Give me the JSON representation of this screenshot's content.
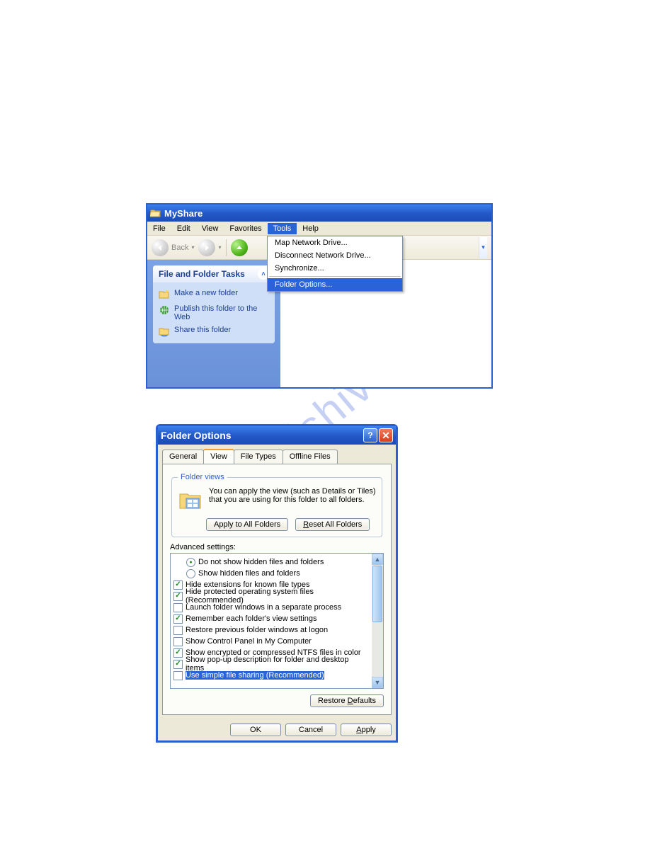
{
  "watermark": "manualshive.com",
  "explorer": {
    "title": "MyShare",
    "menu": {
      "items": [
        "File",
        "Edit",
        "View",
        "Favorites",
        "Tools",
        "Help"
      ],
      "active_index": 4
    },
    "toolbar": {
      "back_label": "Back"
    },
    "tools_menu": [
      "Map Network Drive...",
      "Disconnect Network Drive...",
      "Synchronize..."
    ],
    "tools_menu_selected": "Folder Options...",
    "tasks": {
      "header": "File and Folder Tasks",
      "links": [
        "Make a new folder",
        "Publish this folder to the Web",
        "Share this folder"
      ]
    }
  },
  "dialog": {
    "title": "Folder Options",
    "tabs": [
      "General",
      "View",
      "File Types",
      "Offline Files"
    ],
    "active_tab_index": 1,
    "folder_views": {
      "legend": "Folder views",
      "text": "You can apply the view (such as Details or Tiles) that you are using for this folder to all folders.",
      "apply_btn": "Apply to All Folders",
      "reset_btn": "Reset All Folders"
    },
    "advanced_label": "Advanced settings:",
    "advanced_items": [
      {
        "type": "radio",
        "indent": true,
        "checked": true,
        "label": "Do not show hidden files and folders"
      },
      {
        "type": "radio",
        "indent": true,
        "checked": false,
        "label": "Show hidden files and folders"
      },
      {
        "type": "checkbox",
        "checked": true,
        "label": "Hide extensions for known file types"
      },
      {
        "type": "checkbox",
        "checked": true,
        "label": "Hide protected operating system files (Recommended)"
      },
      {
        "type": "checkbox",
        "checked": false,
        "label": "Launch folder windows in a separate process"
      },
      {
        "type": "checkbox",
        "checked": true,
        "label": "Remember each folder's view settings"
      },
      {
        "type": "checkbox",
        "checked": false,
        "label": "Restore previous folder windows at logon"
      },
      {
        "type": "checkbox",
        "checked": false,
        "label": "Show Control Panel in My Computer"
      },
      {
        "type": "checkbox",
        "checked": true,
        "label": "Show encrypted or compressed NTFS files in color"
      },
      {
        "type": "checkbox",
        "checked": true,
        "label": "Show pop-up description for folder and desktop items"
      },
      {
        "type": "checkbox",
        "checked": false,
        "label": "Use simple file sharing (Recommended)",
        "selected": true
      }
    ],
    "restore_btn": "Restore Defaults",
    "ok_btn": "OK",
    "cancel_btn": "Cancel",
    "apply_btn": "Apply"
  }
}
